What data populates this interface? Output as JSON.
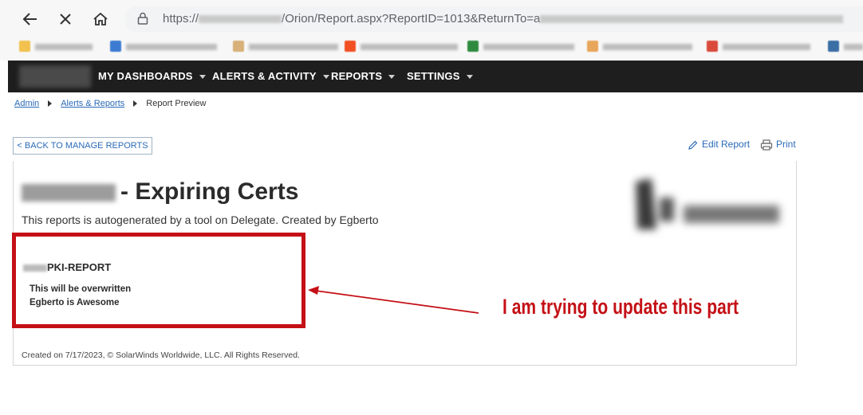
{
  "browser": {
    "url_prefix": "https://",
    "url_path": "/Orion/Report.aspx?ReportID=1013&ReturnTo=a",
    "bookmark_colors": [
      "#f2c14e",
      "#3c7bd1",
      "#d8b07a",
      "#f25022",
      "#2e8b3e",
      "#e8a65b",
      "#d94a3b",
      "#3a6ea5",
      "#34a853"
    ]
  },
  "nav": {
    "menus": [
      {
        "label": "MY DASHBOARDS"
      },
      {
        "label": "ALERTS & ACTIVITY"
      },
      {
        "label": "REPORTS"
      },
      {
        "label": "SETTINGS"
      }
    ]
  },
  "breadcrumb": {
    "items": [
      "Admin",
      "Alerts & Reports"
    ],
    "current": "Report Preview"
  },
  "toolbar": {
    "back_label": "< BACK TO MANAGE REPORTS",
    "edit_label": "Edit Report",
    "print_label": "Print"
  },
  "report": {
    "title": "- Expiring Certs",
    "subtitle": "This reports is autogenerated by a tool on Delegate. Created by Egberto",
    "section_title": "PKI-REPORT",
    "lines": [
      "This will be overwritten",
      "Egberto is Awesome"
    ],
    "footer": "Created on 7/17/2023,   © SolarWinds Worldwide, LLC. All Rights Reserved."
  },
  "annotation": {
    "text": "I am trying to update this part",
    "color": "#c41016"
  }
}
